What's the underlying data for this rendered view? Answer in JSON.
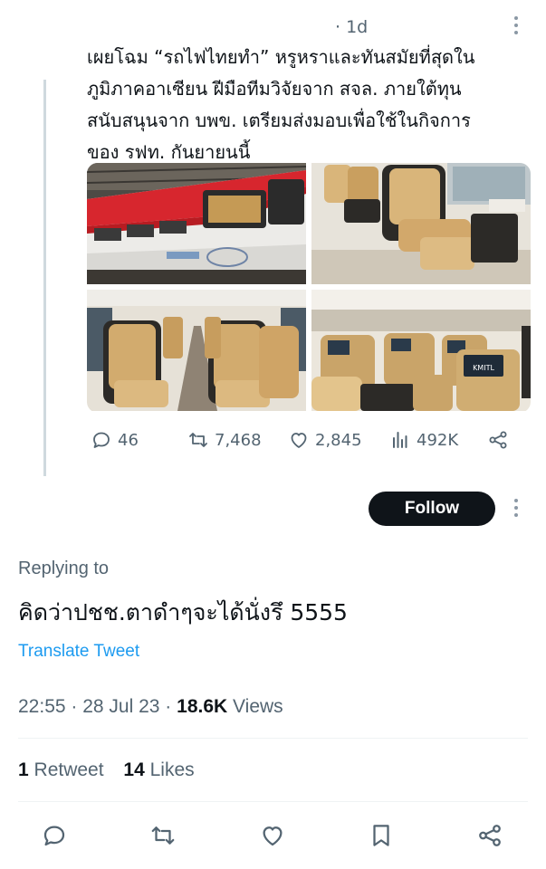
{
  "quoted_tweet": {
    "time_ago": "· 1d",
    "text_lines": [
      "เผยโฉม “รถไฟไทยทำ” หรูหราและทันสมัยที่สุดใน",
      "ภูมิภาคอาเซียน ฝีมือทีมวิจัยจาก สจล. ภายใต้ทุน",
      "สนับสนุนจาก บพข. เตรียมส่งมอบเพื่อใช้ในกิจการ",
      "ของ รฟท. กันยายนนี้"
    ],
    "media": [
      {
        "icon": "train-exterior-photo"
      },
      {
        "icon": "first-class-seat-photo"
      },
      {
        "icon": "train-aisle-photo"
      },
      {
        "icon": "seat-screens-photo",
        "screen_text": "KMITL"
      }
    ],
    "metrics": {
      "replies": "46",
      "retweets": "7,468",
      "likes": "2,845",
      "views": "492K"
    }
  },
  "follow_label": "Follow",
  "reply": {
    "replying_to_label": "Replying to",
    "text": "คิดว่าปชช.ตาดำๆจะได้นั่งรึ 5555",
    "translate_label": "Translate Tweet",
    "time": "22:55",
    "date": "28 Jul 23",
    "views_count": "18.6K",
    "views_label": "Views",
    "retweet_count": "1",
    "retweet_label": "Retweet",
    "likes_count": "14",
    "likes_label": "Likes"
  },
  "colors": {
    "text_primary": "#0f1419",
    "text_secondary": "#536471",
    "link": "#1d9bf0",
    "divider": "#eff3f4",
    "follow_bg": "#0f1419",
    "train_red": "#d7262e",
    "seat_tan": "#d9b57a"
  }
}
